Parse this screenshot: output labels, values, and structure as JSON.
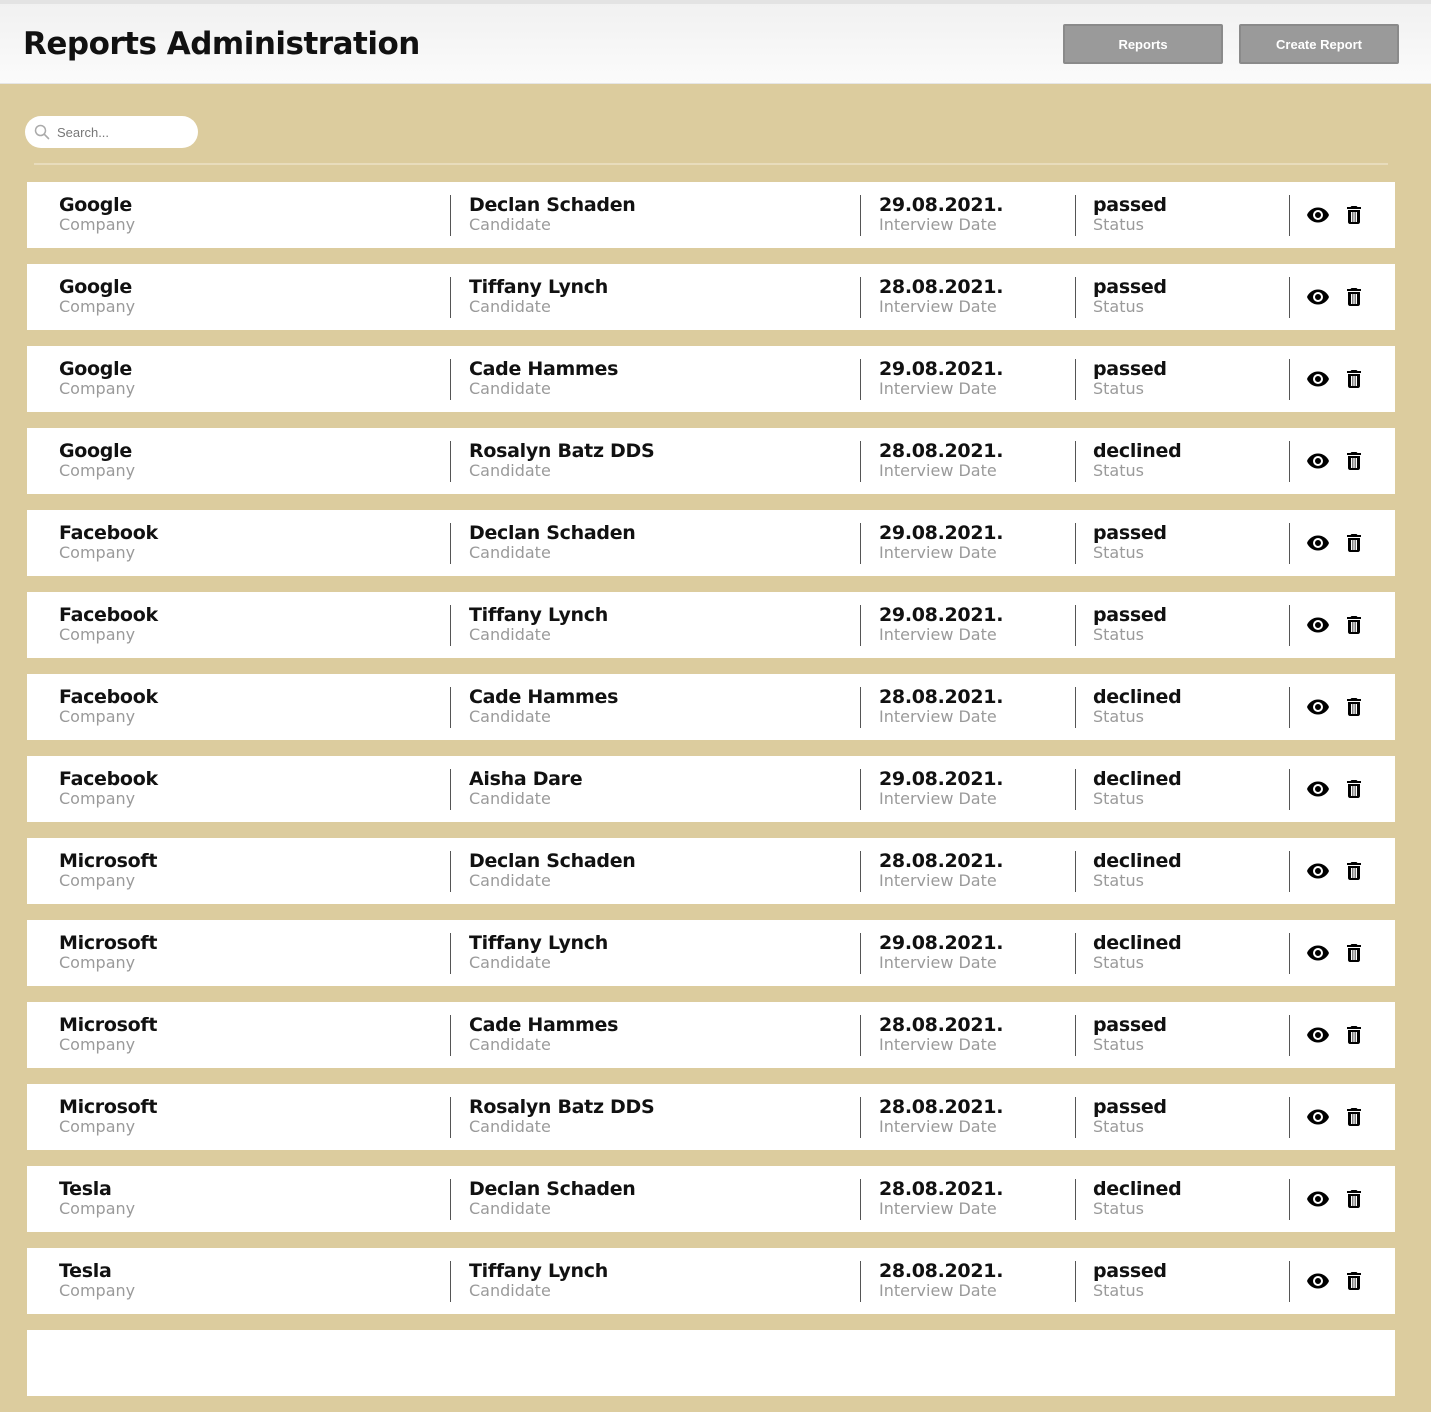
{
  "header": {
    "title": "Reports Administration",
    "reports_label": "Reports",
    "create_label": "Create Report"
  },
  "search": {
    "placeholder": "Search...",
    "value": "",
    "icon": "search-icon"
  },
  "column_labels": {
    "company": "Company",
    "candidate": "Candidate",
    "date": "Interview Date",
    "status": "Status"
  },
  "icons": {
    "view": "eye-icon",
    "delete": "trash-icon"
  },
  "reports": [
    {
      "company": "Google",
      "candidate": "Declan Schaden",
      "date": "29.08.2021.",
      "status": "passed"
    },
    {
      "company": "Google",
      "candidate": "Tiffany Lynch",
      "date": "28.08.2021.",
      "status": "passed"
    },
    {
      "company": "Google",
      "candidate": "Cade Hammes",
      "date": "29.08.2021.",
      "status": "passed"
    },
    {
      "company": "Google",
      "candidate": "Rosalyn Batz DDS",
      "date": "28.08.2021.",
      "status": "declined"
    },
    {
      "company": "Facebook",
      "candidate": "Declan Schaden",
      "date": "29.08.2021.",
      "status": "passed"
    },
    {
      "company": "Facebook",
      "candidate": "Tiffany Lynch",
      "date": "29.08.2021.",
      "status": "passed"
    },
    {
      "company": "Facebook",
      "candidate": "Cade Hammes",
      "date": "28.08.2021.",
      "status": "declined"
    },
    {
      "company": "Facebook",
      "candidate": "Aisha Dare",
      "date": "29.08.2021.",
      "status": "declined"
    },
    {
      "company": "Microsoft",
      "candidate": "Declan Schaden",
      "date": "28.08.2021.",
      "status": "declined"
    },
    {
      "company": "Microsoft",
      "candidate": "Tiffany Lynch",
      "date": "29.08.2021.",
      "status": "declined"
    },
    {
      "company": "Microsoft",
      "candidate": "Cade Hammes",
      "date": "28.08.2021.",
      "status": "passed"
    },
    {
      "company": "Microsoft",
      "candidate": "Rosalyn Batz DDS",
      "date": "28.08.2021.",
      "status": "passed"
    },
    {
      "company": "Tesla",
      "candidate": "Declan Schaden",
      "date": "28.08.2021.",
      "status": "declined"
    },
    {
      "company": "Tesla",
      "candidate": "Tiffany Lynch",
      "date": "28.08.2021.",
      "status": "passed"
    },
    {
      "company": "",
      "candidate": "",
      "date": "",
      "status": ""
    }
  ]
}
